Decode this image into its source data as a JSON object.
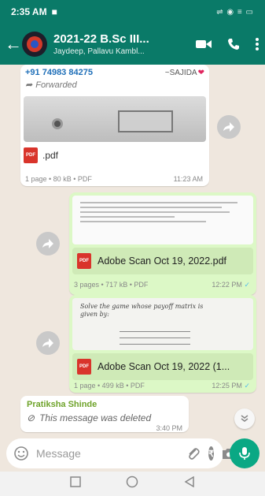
{
  "status_bar": {
    "time": "2:35 AM",
    "indicators": "⇌ ◉ ≡ ▭"
  },
  "header": {
    "title": "2021-22 B.Sc III...",
    "subtitle": "Jaydeep, Pallavu Kambl..."
  },
  "messages": [
    {
      "direction": "incoming",
      "sender_phone": "+91 74983 84275",
      "contact_name": "~SAJIDA",
      "forwarded_label": "Forwarded",
      "file_name": ".pdf",
      "meta": "1 page • 80 kB • PDF",
      "time": "11:23 AM"
    },
    {
      "direction": "outgoing",
      "file_name": "Adobe Scan Oct 19, 2022.pdf",
      "meta": "3 pages • 717 kB • PDF",
      "time": "12:22 PM"
    },
    {
      "direction": "outgoing",
      "preview_text": "Solve the game whose payoff matrix is given by:",
      "file_name": "Adobe Scan Oct 19, 2022 (1...",
      "meta": "1 page • 499 kB • PDF",
      "time": "12:25 PM"
    },
    {
      "direction": "incoming",
      "sender_name": "Pratiksha Shinde",
      "text": "This message was deleted",
      "time": "3:40 PM"
    }
  ],
  "composer": {
    "placeholder": "Message"
  },
  "pdf_badge": "PDF",
  "icons": [
    "back-arrow-icon",
    "video-call-icon",
    "voice-call-icon",
    "more-options-icon",
    "forward-icon",
    "emoji-icon",
    "attach-icon",
    "rupee-icon",
    "camera-icon",
    "mic-icon",
    "blocked-icon",
    "chevron-double-down-icon"
  ],
  "colors": {
    "header": "#0a7a68",
    "outgoing_bubble": "#dcf8c6",
    "chat_bg": "#efe7de",
    "mic": "#0aa884",
    "pdf": "#d9342b"
  }
}
